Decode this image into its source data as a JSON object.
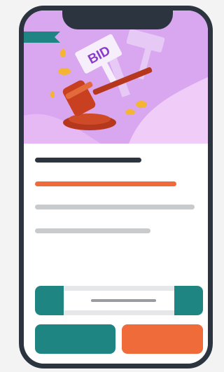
{
  "hero": {
    "sign_text": "BID",
    "colors": {
      "background": "#d9a6f0",
      "accent_wave": "#f0cef8",
      "gavel": "#b5371d",
      "coin": "#f4b533",
      "flag": "#1e8583"
    },
    "icons": [
      "bookmark-flag-icon",
      "bid-sign-icon",
      "gavel-icon",
      "coin-icon"
    ]
  },
  "colors": {
    "frame": "#2c3440",
    "primary": "#1e8583",
    "accent": "#ef6b3a",
    "placeholder_text": "#c9cacc"
  }
}
